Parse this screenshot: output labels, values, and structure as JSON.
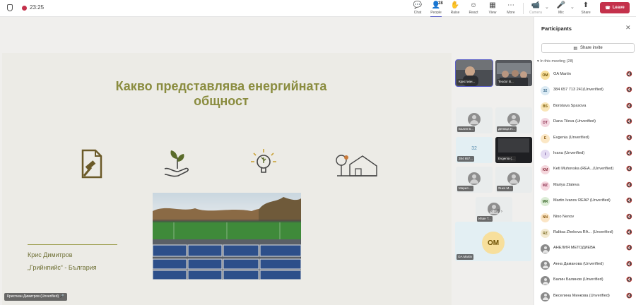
{
  "header": {
    "timer": "23:25",
    "toolbar": {
      "chat": "Chat",
      "people": "People",
      "people_count": "28",
      "raise": "Raise",
      "react": "React",
      "view": "View",
      "more": "More",
      "camera": "Camera",
      "mic": "Mic",
      "share": "Share",
      "leave": "Leave"
    }
  },
  "slide": {
    "title": "Какво представлява енергийната общност",
    "author_name": "Крис Димитров",
    "author_org": "„Грийнпийс“ - България",
    "icons": [
      "document-hammer-icon",
      "hand-plant-icon",
      "lightbulb-icon",
      "tree-house-icon"
    ]
  },
  "presenter_tag": "Кристиан Димитров (Unverified)",
  "video_tiles": [
    {
      "label": "Кристиан...",
      "kind": "video"
    },
    {
      "label": "Teodor B...",
      "kind": "video"
    },
    {
      "label": "Балин Б...",
      "kind": "avatar"
    },
    {
      "label": "Деница Н...",
      "kind": "avatar"
    },
    {
      "label": "384 657...",
      "kind": "number",
      "number": "32"
    },
    {
      "label": "Evgenia (...",
      "kind": "video"
    },
    {
      "label": "Мария ...",
      "kind": "avatar"
    },
    {
      "label": "Янко М...",
      "kind": "avatar"
    },
    {
      "label": "Иван Т...",
      "kind": "avatar"
    }
  ],
  "pager": {
    "text": "1/3"
  },
  "featured_tile": {
    "initials": "OM",
    "label": "OA Martin"
  },
  "participants": {
    "title": "Participants",
    "share_invite": "Share invite",
    "section": "In this meeting (28)",
    "people": [
      {
        "initials": "OM",
        "name": "OA Martin",
        "bg": "#f7df9c",
        "fg": "#6b4e00"
      },
      {
        "initials": "32",
        "name": "384 657 713 241(Unverified)",
        "bg": "#dbeaf3",
        "fg": "#3a6a8a"
      },
      {
        "initials": "BS",
        "name": "Borislava Spasova",
        "bg": "#f9e6b8",
        "fg": "#7a5a00"
      },
      {
        "initials": "DT",
        "name": "Dana Tileva (Unverified)",
        "bg": "#f3d6e0",
        "fg": "#8a2c4c"
      },
      {
        "initials": "E",
        "name": "Evgenia (Unverified)",
        "bg": "#fbe7c5",
        "fg": "#8a5a10"
      },
      {
        "initials": "I",
        "name": "Ivana (Unverified)",
        "bg": "#e5dcf3",
        "fg": "#5a3f8a"
      },
      {
        "initials": "KM",
        "name": "Keti Muhovska (REA...(Unverified)",
        "bg": "#f4d6dc",
        "fg": "#8a2c3c"
      },
      {
        "initials": "MZ",
        "name": "Mariya Zlateva",
        "bg": "#f6d7df",
        "fg": "#8a2c4c"
      },
      {
        "initials": "MR",
        "name": "Martin Ivanov REAP (Unverified)",
        "bg": "#dcecd6",
        "fg": "#3c6a2c"
      },
      {
        "initials": "NN",
        "name": "Nino Nenov",
        "bg": "#fbe5c5",
        "fg": "#8a5a10"
      },
      {
        "initials": "RZ",
        "name": "Ralitsa Zhekova RA... (Unverified)",
        "bg": "#f3ead0",
        "fg": "#7a6a20"
      },
      {
        "initials": "",
        "name": "АНЕЛИЯ МЕТОДИЕВА",
        "bg": "",
        "fg": ""
      },
      {
        "initials": "",
        "name": "Анна Даманова (Unverified)",
        "bg": "",
        "fg": ""
      },
      {
        "initials": "",
        "name": "Балин Балинов (Unverified)",
        "bg": "",
        "fg": ""
      },
      {
        "initials": "",
        "name": "Веселина Минкова (Unverified)",
        "bg": "",
        "fg": ""
      }
    ]
  },
  "colors": {
    "accent": "#5b5fc7",
    "leave": "#c4314b",
    "slide_title": "#8a8c3f"
  }
}
